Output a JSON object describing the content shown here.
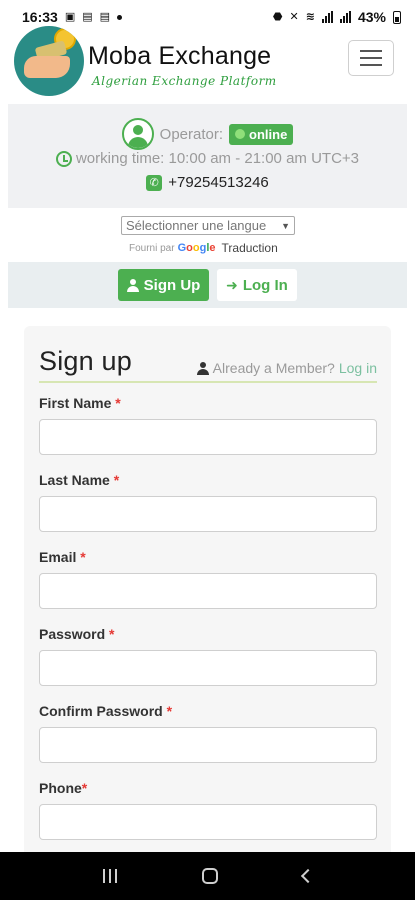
{
  "status_bar": {
    "time": "16:33",
    "battery": "43%"
  },
  "header": {
    "brand": "Moba Exchange",
    "tagline": "Algerian Exchange Platform"
  },
  "operator": {
    "label": "Operator:",
    "status": "online",
    "working_time": "working time: 10:00 am - 21:00 am UTC+3",
    "phone": "+79254513246"
  },
  "language": {
    "select_value": "Sélectionner une langue",
    "powered_by": "Fourni par",
    "google": [
      "G",
      "o",
      "o",
      "g",
      "l",
      "e"
    ],
    "traduction": "Traduction"
  },
  "auth": {
    "signup_label": "Sign Up",
    "login_label": "Log In"
  },
  "form": {
    "title": "Sign up",
    "member_text": "Already a Member?",
    "member_link": "Log in",
    "fields": [
      {
        "label": "First Name",
        "required_mark": " *"
      },
      {
        "label": "Last Name",
        "required_mark": " *"
      },
      {
        "label": "Email",
        "required_mark": " *"
      },
      {
        "label": "Password",
        "required_mark": " *"
      },
      {
        "label": "Confirm Password",
        "required_mark": " *"
      },
      {
        "label": "Phone",
        "required_mark": "*"
      }
    ]
  },
  "colors": {
    "accent_green": "#4caf50",
    "brand_teal": "#2a8c86"
  }
}
